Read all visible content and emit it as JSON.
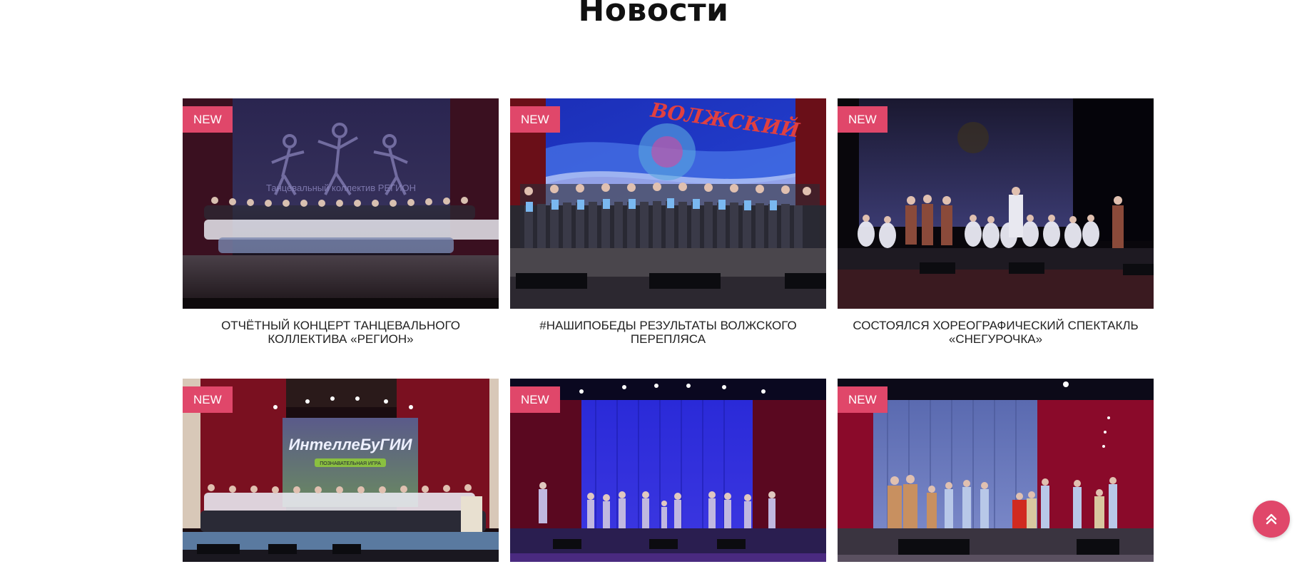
{
  "page": {
    "title": "Новости"
  },
  "news": {
    "badge_label": "NEW",
    "items": [
      {
        "title": "ОТЧЁТНЫЙ КОНЦЕРТ ТАНЦЕВАЛЬНОГО КОЛЛЕКТИВА «РЕГИОН»",
        "photo_text": "Танцевальный коллектив РЕГИОН"
      },
      {
        "title": "#НАШИПОБЕДЫ РЕЗУЛЬТАТЫ ВОЛЖСКОГО ПЕРЕПЛЯСА",
        "photo_text": "ВОЛЖСКИЙ"
      },
      {
        "title": "СОСТОЯЛСЯ ХОРЕОГРАФИЧЕСКИЙ СПЕКТАКЛЬ «СНЕГУРОЧКА»"
      },
      {
        "title": "",
        "photo_text": "ИнтеллеБуГИИ",
        "photo_subtext": "ПОЗНАВАТЕЛЬНАЯ ИГРА"
      },
      {
        "title": ""
      },
      {
        "title": ""
      }
    ]
  },
  "scroll_top": {
    "icon": "double-chevron-up-icon"
  },
  "colors": {
    "accent": "#e0476a",
    "text": "#222222",
    "background": "#ffffff"
  }
}
